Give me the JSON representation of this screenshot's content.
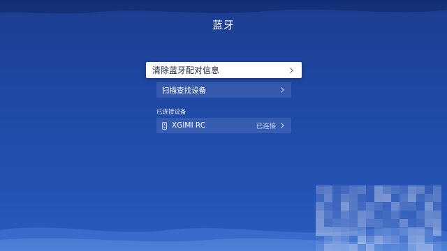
{
  "header": {
    "title": "蓝牙"
  },
  "menu": {
    "clear_pairing_label": "清除蓝牙配对信息",
    "scan_devices_label": "扫描查找设备"
  },
  "connected_section": {
    "label": "已连接设备",
    "devices": [
      {
        "name": "XGIMI RC",
        "status": "已连接",
        "icon": "remote-control-icon"
      }
    ]
  },
  "colors": {
    "background_top": "#1b3d8f",
    "background_bottom": "#2a5cc0",
    "focused_item_bg": "#ffffff",
    "focused_item_text": "#1f2a44"
  }
}
